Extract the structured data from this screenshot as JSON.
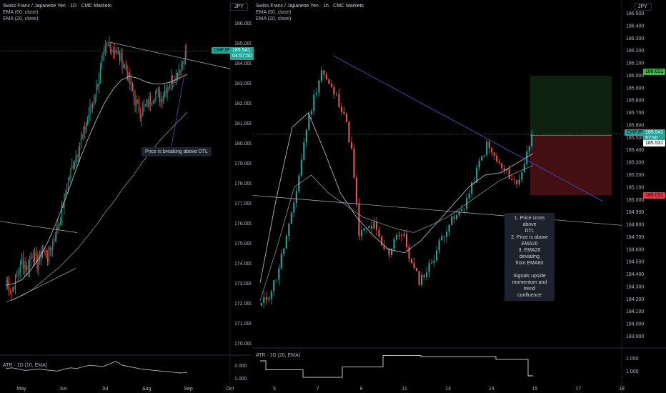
{
  "left_chart": {
    "title": "Swiss Franc / Japanese Yen · 1D · CMC Markets",
    "indicators": [
      "EMA (60, close)",
      "EMA (20, close)"
    ],
    "currency_button": "JPY",
    "symbol_tag": "CHFJPY",
    "last_price": "185.541",
    "countdown": "04:57:50",
    "annotation": "Price is breaking above DTL",
    "atr_label": "ATR · 1D (10, EMA)",
    "price_ticks": [
      "186.000",
      "185.000",
      "184.000",
      "183.000",
      "182.000",
      "181.000",
      "180.000",
      "179.000",
      "178.000",
      "177.000",
      "176.000",
      "175.000",
      "174.000",
      "173.000",
      "172.000",
      "171.000",
      "170.000"
    ],
    "atr_ticks": [
      "2.000",
      "1.000"
    ],
    "time_ticks": [
      "May",
      "Jun",
      "Jul",
      "Aug",
      "Sep",
      "Oct"
    ]
  },
  "right_chart": {
    "title": "Swiss Franc / Japanese Yen · 1h · CMC Markets",
    "indicators": [
      "EMA (60, close)",
      "EMA (20, close)"
    ],
    "currency_button": "JPY",
    "symbol_tag": "CHFJPY",
    "last_price": "185.541",
    "countdown": "57:50",
    "entry_label": "185.531",
    "target_label": "186.031",
    "stop_label": "185.031",
    "atr_label": "ATR · 1D (20, EMA)",
    "note_lines": [
      "1. Price cross above",
      "DTL",
      "2. Price is above",
      "EMA20",
      "3. EMA20 deviating",
      "from EMA60",
      "",
      "Signals upside",
      "momentum and trend",
      "confluence"
    ],
    "price_ticks": [
      "186.500",
      "186.400",
      "186.300",
      "186.200",
      "186.100",
      "186.000",
      "185.900",
      "185.800",
      "185.700",
      "185.600",
      "185.500",
      "185.400",
      "185.300",
      "185.200",
      "185.100",
      "185.000",
      "184.900",
      "184.800",
      "184.700",
      "184.600",
      "184.500",
      "184.400",
      "184.300",
      "184.200",
      "184.100",
      "184.000",
      "183.900"
    ],
    "atr_ticks": [
      "1.050",
      "1.000"
    ],
    "time_ticks": [
      "5",
      "7",
      "9",
      "11",
      "13",
      "14",
      "15",
      "17",
      "18"
    ]
  },
  "chart_data": [
    {
      "type": "candlestick",
      "title": "Swiss Franc / Japanese Yen · 1D · CMC Markets",
      "x": [
        "May",
        "Jun",
        "Jul",
        "Aug",
        "Sep",
        "Oct"
      ],
      "ylim": [
        170,
        187
      ],
      "close_path": [
        173.4,
        172.8,
        173.6,
        174.4,
        174.0,
        174.8,
        174.2,
        175.0,
        174.6,
        175.4,
        176.2,
        177.4,
        178.6,
        179.6,
        180.4,
        181.2,
        182.2,
        183.0,
        184.2,
        185.4,
        185.9,
        185.6,
        185.2,
        184.8,
        183.8,
        182.9,
        182.3,
        182.6,
        183.0,
        183.4,
        183.0,
        183.6,
        184.0,
        184.3,
        184.9,
        185.5
      ],
      "series": [
        {
          "name": "EMA (60, close)",
          "values": [
            172.2,
            172.4,
            172.6,
            172.9,
            173.3,
            173.7,
            174.1,
            174.6,
            175.1,
            175.7,
            176.3,
            177.0,
            177.6,
            178.3,
            178.9,
            179.6,
            180.2,
            180.8,
            181.3,
            181.8,
            182.3
          ]
        },
        {
          "name": "EMA (20, close)",
          "values": [
            173.1,
            173.2,
            173.4,
            173.9,
            174.5,
            175.3,
            176.3,
            177.4,
            178.6,
            179.8,
            180.9,
            181.9,
            182.8,
            183.5,
            184.0,
            184.2,
            184.1,
            183.9,
            183.8,
            183.8,
            183.9,
            184.1,
            184.3
          ]
        }
      ],
      "last_price": 185.541
    },
    {
      "type": "candlestick",
      "title": "Swiss Franc / Japanese Yen · 1h · CMC Markets",
      "x": [
        "5",
        "7",
        "9",
        "11",
        "13",
        "14",
        "15",
        "17",
        "18"
      ],
      "ylim": [
        183.85,
        186.55
      ],
      "close_path": [
        184.12,
        184.2,
        184.35,
        184.6,
        184.85,
        185.2,
        185.6,
        185.85,
        186.08,
        185.95,
        185.85,
        185.72,
        185.4,
        184.7,
        184.75,
        184.78,
        184.6,
        184.55,
        184.72,
        184.68,
        184.45,
        184.32,
        184.4,
        184.52,
        184.68,
        184.8,
        184.85,
        184.95,
        185.1,
        185.3,
        185.45,
        185.35,
        185.25,
        185.2,
        185.12,
        185.3,
        185.54
      ],
      "series": [
        {
          "name": "EMA (60, close)",
          "values": [
            184.15,
            184.6,
            185.1,
            185.2,
            185.05,
            184.95,
            184.85,
            184.8,
            184.75,
            184.72,
            184.78,
            184.85,
            184.95,
            185.05,
            185.15,
            185.22,
            185.28
          ]
        },
        {
          "name": "EMA (20, close)",
          "values": [
            184.3,
            185.0,
            185.6,
            185.72,
            185.4,
            185.05,
            184.85,
            184.7,
            184.58,
            184.55,
            184.65,
            184.8,
            184.95,
            185.1,
            185.2,
            185.22,
            185.3,
            185.38
          ]
        }
      ],
      "position": {
        "entry": 185.531,
        "target": 186.031,
        "stop": 185.031
      },
      "last_price": 185.541
    }
  ],
  "colors": {
    "up": "#26a69a",
    "down": "#ef5350",
    "ema60": "#9598a1",
    "ema20": "#d1d4dc",
    "dtl": "#3f51b5",
    "target": "#4caf50",
    "stop": "#f23645",
    "tag": "#26a69a"
  }
}
